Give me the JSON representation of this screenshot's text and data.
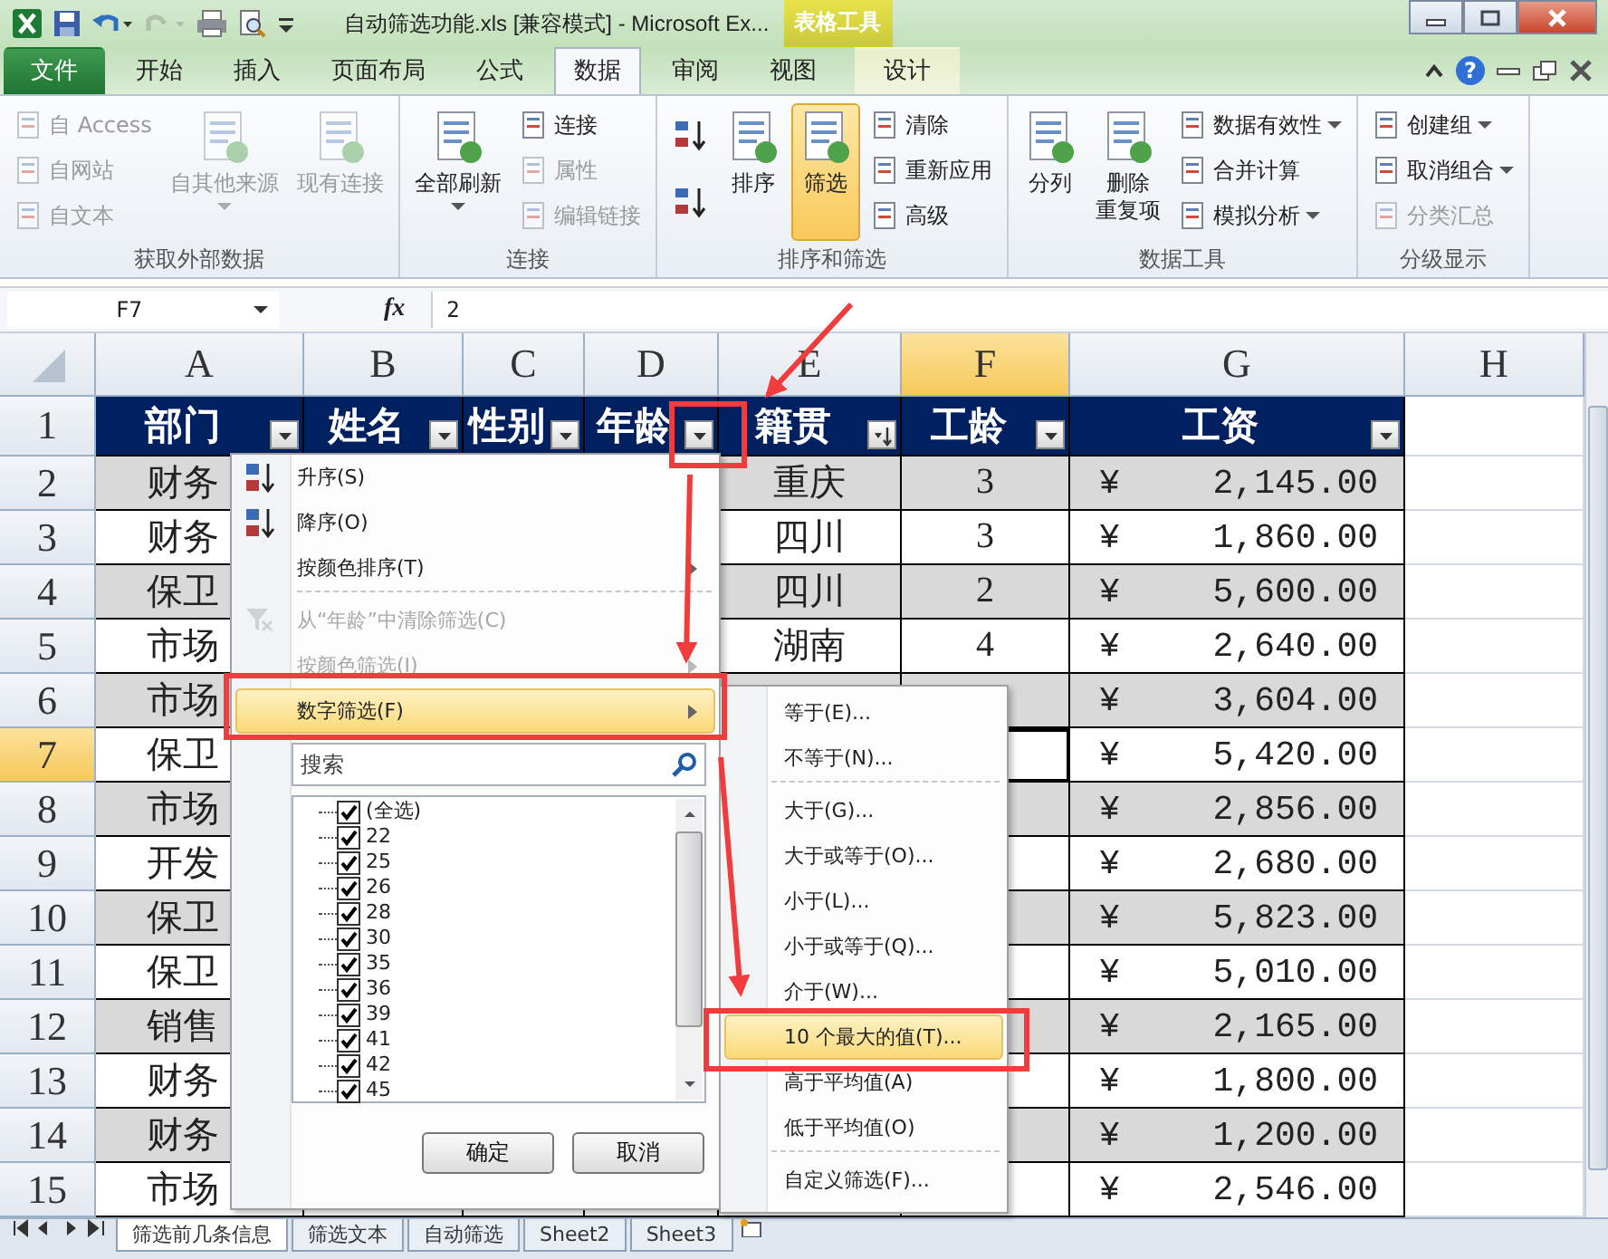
{
  "title_bar": {
    "title": "自动筛选功能.xls  [兼容模式]  -  Microsoft Ex...",
    "context_label": "表格工具"
  },
  "ribbon_tabs": [
    {
      "label": "文件",
      "kind": "file",
      "selected": false
    },
    {
      "label": "开始",
      "kind": "normal",
      "selected": false
    },
    {
      "label": "插入",
      "kind": "normal",
      "selected": false
    },
    {
      "label": "页面布局",
      "kind": "normal",
      "selected": false
    },
    {
      "label": "公式",
      "kind": "normal",
      "selected": false
    },
    {
      "label": "数据",
      "kind": "normal",
      "selected": true
    },
    {
      "label": "审阅",
      "kind": "normal",
      "selected": false
    },
    {
      "label": "视图",
      "kind": "normal",
      "selected": false
    },
    {
      "label": "设计",
      "kind": "context",
      "selected": false
    }
  ],
  "ribbon_help": "?",
  "ribbon_groups": [
    {
      "label": "获取外部数据",
      "items": [
        {
          "kind": "small",
          "label": "自 Access",
          "disabled": true,
          "pressed": false,
          "menu": false
        },
        {
          "kind": "small",
          "label": "自网站",
          "disabled": true,
          "pressed": false,
          "menu": false
        },
        {
          "kind": "small",
          "label": "自文本",
          "disabled": true,
          "pressed": false,
          "menu": false
        },
        {
          "kind": "large",
          "label": "自其他来源",
          "disabled": true,
          "pressed": false,
          "menu": true
        },
        {
          "kind": "large",
          "label": "现有连接",
          "disabled": true,
          "pressed": false,
          "menu": false
        }
      ]
    },
    {
      "label": "连接",
      "items": [
        {
          "kind": "large",
          "label": "全部刷新",
          "disabled": false,
          "pressed": false,
          "menu": true
        },
        {
          "kind": "small",
          "label": "连接",
          "disabled": false,
          "pressed": false,
          "menu": false
        },
        {
          "kind": "small",
          "label": "属性",
          "disabled": true,
          "pressed": false,
          "menu": false
        },
        {
          "kind": "small",
          "label": "编辑链接",
          "disabled": true,
          "pressed": false,
          "menu": false
        }
      ]
    },
    {
      "label": "排序和筛选",
      "items": [
        {
          "kind": "icon",
          "disabled": false,
          "pressed": false,
          "menu": false
        },
        {
          "kind": "icon",
          "disabled": false,
          "pressed": false,
          "menu": false
        },
        {
          "kind": "large",
          "label": "排序",
          "disabled": false,
          "pressed": false,
          "menu": false
        },
        {
          "kind": "large",
          "label": "筛选",
          "disabled": false,
          "pressed": true,
          "menu": false
        },
        {
          "kind": "small",
          "label": "清除",
          "disabled": false,
          "pressed": false,
          "menu": false
        },
        {
          "kind": "small",
          "label": "重新应用",
          "disabled": false,
          "pressed": false,
          "menu": false
        },
        {
          "kind": "small",
          "label": "高级",
          "disabled": false,
          "pressed": false,
          "menu": false
        }
      ]
    },
    {
      "label": "数据工具",
      "items": [
        {
          "kind": "large",
          "label": "分列",
          "disabled": false,
          "pressed": false,
          "menu": false
        },
        {
          "kind": "large",
          "label": "删除",
          "label_line_2": "重复项",
          "disabled": false,
          "pressed": false,
          "menu": false
        },
        {
          "kind": "small",
          "label": "数据有效性",
          "disabled": false,
          "pressed": false,
          "menu": true
        },
        {
          "kind": "small",
          "label": "合并计算",
          "disabled": false,
          "pressed": false,
          "menu": false
        },
        {
          "kind": "small",
          "label": "模拟分析",
          "disabled": false,
          "pressed": false,
          "menu": true
        }
      ]
    },
    {
      "label": "分级显示",
      "items": [
        {
          "kind": "small",
          "label": "创建组",
          "disabled": false,
          "pressed": false,
          "menu": true
        },
        {
          "kind": "small",
          "label": "取消组合",
          "disabled": false,
          "pressed": false,
          "menu": true
        },
        {
          "kind": "small",
          "label": "分类汇总",
          "disabled": true,
          "pressed": false,
          "menu": false
        }
      ]
    }
  ],
  "formula_bar": {
    "name_box": "F7",
    "fx": "fx",
    "value": "2"
  },
  "columns": [
    {
      "label": "A",
      "selected": false
    },
    {
      "label": "B",
      "selected": false
    },
    {
      "label": "C",
      "selected": false
    },
    {
      "label": "D",
      "selected": false
    },
    {
      "label": "E",
      "selected": false
    },
    {
      "label": "F",
      "selected": true
    },
    {
      "label": "G",
      "selected": false
    },
    {
      "label": "H",
      "selected": false
    }
  ],
  "header_row": {
    "row": "1",
    "selected": false,
    "cells": [
      {
        "label": "部门",
        "sorted": false
      },
      {
        "label": "姓名",
        "sorted": false
      },
      {
        "label": "性别",
        "sorted": false
      },
      {
        "label": "年龄",
        "sorted": false
      },
      {
        "label": "籍贯",
        "sorted": true
      },
      {
        "label": "工龄",
        "sorted": false
      },
      {
        "label": "工资",
        "sorted": false
      }
    ]
  },
  "rows": [
    {
      "row": "2",
      "selected": false,
      "dept": "财务",
      "origin": "重庆",
      "years": "3",
      "currency": "¥",
      "salary": "2,145.00"
    },
    {
      "row": "3",
      "selected": false,
      "dept": "财务",
      "origin": "四川",
      "years": "3",
      "currency": "¥",
      "salary": "1,860.00"
    },
    {
      "row": "4",
      "selected": false,
      "dept": "保卫",
      "origin": "四川",
      "years": "2",
      "currency": "¥",
      "salary": "5,600.00"
    },
    {
      "row": "5",
      "selected": false,
      "dept": "市场",
      "origin": "湖南",
      "years": "4",
      "currency": "¥",
      "salary": "2,640.00"
    },
    {
      "row": "6",
      "selected": false,
      "dept": "市场",
      "currency": "¥",
      "salary": "3,604.00"
    },
    {
      "row": "7",
      "selected": true,
      "dept": "保卫",
      "currency": "¥",
      "salary": "5,420.00"
    },
    {
      "row": "8",
      "selected": false,
      "dept": "市场",
      "currency": "¥",
      "salary": "2,856.00"
    },
    {
      "row": "9",
      "selected": false,
      "dept": "开发",
      "currency": "¥",
      "salary": "2,680.00"
    },
    {
      "row": "10",
      "selected": false,
      "dept": "保卫",
      "currency": "¥",
      "salary": "5,823.00"
    },
    {
      "row": "11",
      "selected": false,
      "dept": "保卫",
      "currency": "¥",
      "salary": "5,010.00"
    },
    {
      "row": "12",
      "selected": false,
      "dept": "销售",
      "currency": "¥",
      "salary": "2,165.00"
    },
    {
      "row": "13",
      "selected": false,
      "dept": "财务",
      "currency": "¥",
      "salary": "1,800.00"
    },
    {
      "row": "14",
      "selected": false,
      "dept": "财务",
      "currency": "¥",
      "salary": "1,200.00"
    },
    {
      "row": "15",
      "selected": false,
      "dept": "市场",
      "currency": "¥",
      "salary": "2,546.00"
    }
  ],
  "filter_menu": {
    "items": [
      {
        "label": "升序(S)",
        "kind": "sort",
        "disabled": false,
        "highlighted": false,
        "submenu": false,
        "separator_before": false
      },
      {
        "label": "降序(O)",
        "kind": "sort",
        "disabled": false,
        "highlighted": false,
        "submenu": false,
        "separator_before": false
      },
      {
        "label": "按颜色排序(T)",
        "kind": "plain",
        "disabled": false,
        "highlighted": false,
        "submenu": true,
        "separator_before": false
      },
      {
        "label": "从“年龄”中清除筛选(C)",
        "kind": "clear",
        "disabled": true,
        "highlighted": false,
        "submenu": false,
        "separator_before": true
      },
      {
        "label": "按颜色筛选(I)",
        "kind": "plain",
        "disabled": true,
        "highlighted": false,
        "submenu": true,
        "separator_before": false
      },
      {
        "label": "数字筛选(F)",
        "kind": "plain",
        "disabled": false,
        "highlighted": true,
        "submenu": true,
        "separator_before": false
      }
    ],
    "search": {
      "placeholder": "搜索"
    },
    "values": [
      {
        "label": "(全选)",
        "checked": true
      },
      {
        "label": "22",
        "checked": true
      },
      {
        "label": "25",
        "checked": true
      },
      {
        "label": "26",
        "checked": true
      },
      {
        "label": "28",
        "checked": true
      },
      {
        "label": "30",
        "checked": true
      },
      {
        "label": "35",
        "checked": true
      },
      {
        "label": "36",
        "checked": true
      },
      {
        "label": "39",
        "checked": true
      },
      {
        "label": "41",
        "checked": true
      },
      {
        "label": "42",
        "checked": true
      },
      {
        "label": "45",
        "checked": true
      }
    ],
    "buttons": [
      "确定",
      "取消"
    ]
  },
  "number_filter_menu": {
    "items": [
      {
        "label": "等于(E)...",
        "highlighted": false,
        "separator_before": false
      },
      {
        "label": "不等于(N)...",
        "highlighted": false,
        "separator_before": false
      },
      {
        "label": "大于(G)...",
        "highlighted": false,
        "separator_before": true
      },
      {
        "label": "大于或等于(O)...",
        "highlighted": false,
        "separator_before": false
      },
      {
        "label": "小于(L)...",
        "highlighted": false,
        "separator_before": false
      },
      {
        "label": "小于或等于(Q)...",
        "highlighted": false,
        "separator_before": false
      },
      {
        "label": "介于(W)...",
        "highlighted": false,
        "separator_before": false
      },
      {
        "label": "10 个最大的值(T)...",
        "highlighted": true,
        "separator_before": false
      },
      {
        "label": "高于平均值(A)",
        "highlighted": false,
        "separator_before": false
      },
      {
        "label": "低于平均值(O)",
        "highlighted": false,
        "separator_before": false
      },
      {
        "label": "自定义筛选(F)...",
        "highlighted": false,
        "separator_before": true
      }
    ]
  },
  "sheet_tabs": [
    {
      "label": "筛选前几条信息",
      "selected": true
    },
    {
      "label": "筛选文本",
      "selected": false
    },
    {
      "label": "自动筛选",
      "selected": false
    },
    {
      "label": "Sheet2",
      "selected": false
    },
    {
      "label": "Sheet3",
      "selected": false
    }
  ]
}
